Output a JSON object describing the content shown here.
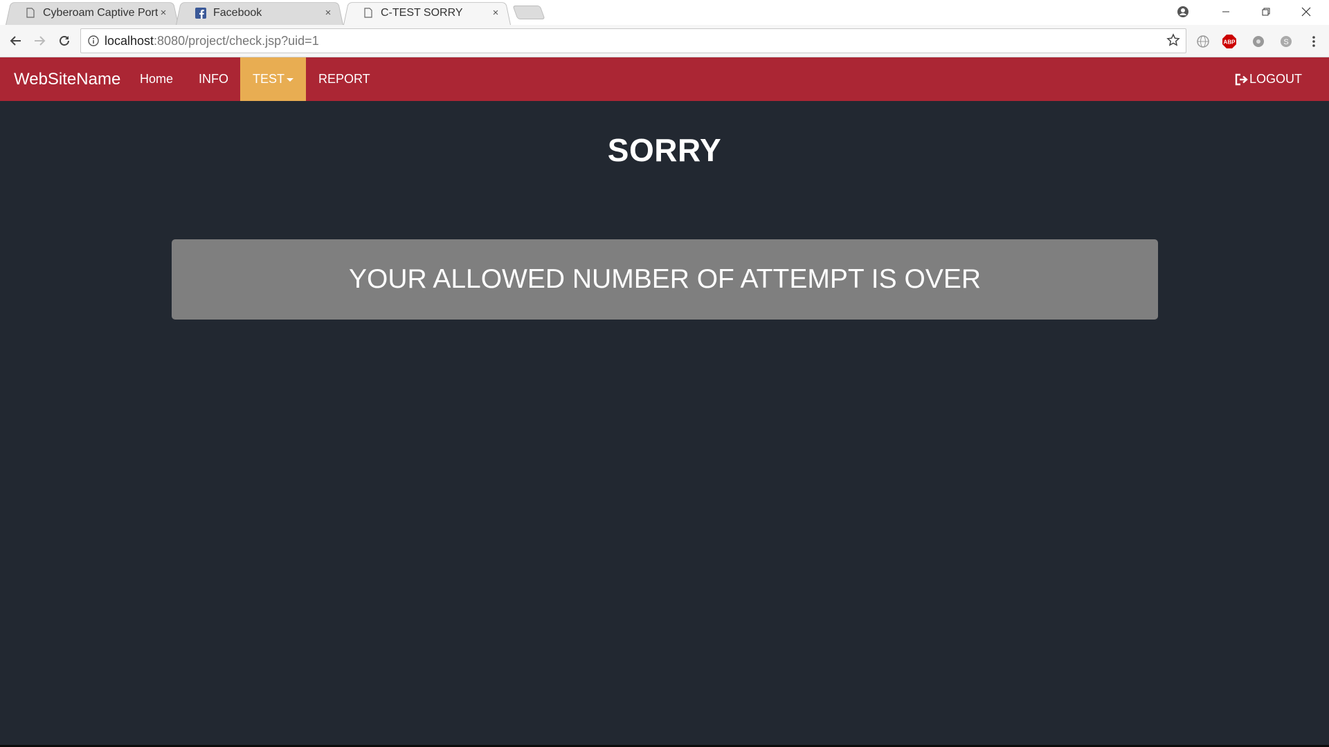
{
  "browser": {
    "tabs": [
      {
        "title": "Cyberoam Captive Portal",
        "icon": "page-icon",
        "close": "×",
        "active": false
      },
      {
        "title": "Facebook",
        "icon": "facebook-icon",
        "close": "×",
        "active": false
      },
      {
        "title": "C-TEST SORRY",
        "icon": "page-icon",
        "close": "×",
        "active": true
      }
    ],
    "url": {
      "host": "localhost",
      "path": ":8080/project/check.jsp?uid=1"
    },
    "extensions": [
      "globe-icon",
      "adblock-icon",
      "extension-icon",
      "skype-icon"
    ],
    "abp_label": "ABP"
  },
  "nav": {
    "brand": "WebSiteName",
    "links": [
      "Home",
      "INFO",
      "TEST",
      "REPORT"
    ],
    "logout": "LOGOUT",
    "colors": {
      "bar": "#ab2634",
      "active": "#e8ad52"
    }
  },
  "page": {
    "title": "SORRY",
    "message": "YOUR ALLOWED NUMBER OF ATTEMPT IS OVER",
    "background": "#222831"
  }
}
